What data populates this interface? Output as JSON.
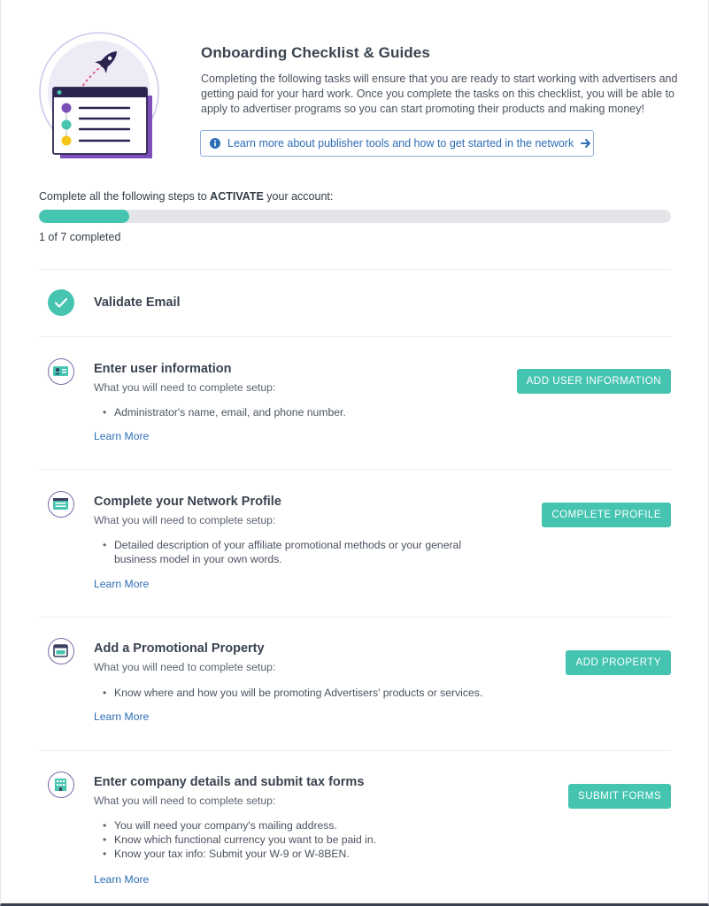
{
  "header": {
    "title": "Onboarding Checklist & Guides",
    "description": "Completing the following tasks will ensure that you are ready to start working with advertisers and getting paid for your hard work. Once you complete the tasks on this checklist, you will be able to apply to advertiser programs so you can start promoting their products and making money!",
    "learn_link": "Learn more about publisher tools and how to get started in the network"
  },
  "progress": {
    "caption_before": "Complete all the following steps to ",
    "caption_bold": "ACTIVATE",
    "caption_after": " your account:",
    "completed": 1,
    "total": 7,
    "fraction": 0.143,
    "count_text": "1 of 7 completed"
  },
  "steps": [
    {
      "title": "Validate Email",
      "status": "complete",
      "icon": "check-icon"
    },
    {
      "title": "Enter user information",
      "status": "incomplete",
      "icon": "user-card-icon",
      "subtitle": "What you will need to complete setup:",
      "items": [
        "Administrator's name, email, and phone number."
      ],
      "learn_more": "Learn More",
      "button": "ADD USER INFORMATION"
    },
    {
      "title": "Complete your Network Profile",
      "status": "incomplete",
      "icon": "profile-icon",
      "subtitle": "What you will need to complete setup:",
      "items": [
        "Detailed description of your affiliate promotional methods or your general business model in your own words."
      ],
      "learn_more": "Learn More",
      "button": "COMPLETE PROFILE"
    },
    {
      "title": "Add a Promotional Property",
      "status": "incomplete",
      "icon": "browser-window-icon",
      "subtitle": "What you will need to complete setup:",
      "items": [
        "Know where and how you will be promoting Advertisers' products or services."
      ],
      "learn_more": "Learn More",
      "button": "ADD PROPERTY"
    },
    {
      "title": "Enter company details and submit tax forms",
      "status": "incomplete",
      "icon": "building-icon",
      "subtitle": "What you will need to complete setup:",
      "items": [
        "You will need your company's mailing address.",
        "Know which functional currency you want to be paid in.",
        "Know your tax info: Submit your W-9 or W-8BEN."
      ],
      "learn_more": "Learn More",
      "button": "SUBMIT FORMS"
    }
  ],
  "colors": {
    "accent": "#45c4b0",
    "link": "#2d6db5",
    "icon_border": "#7b6aa8",
    "illustration_purple": "#7d4fb8"
  }
}
